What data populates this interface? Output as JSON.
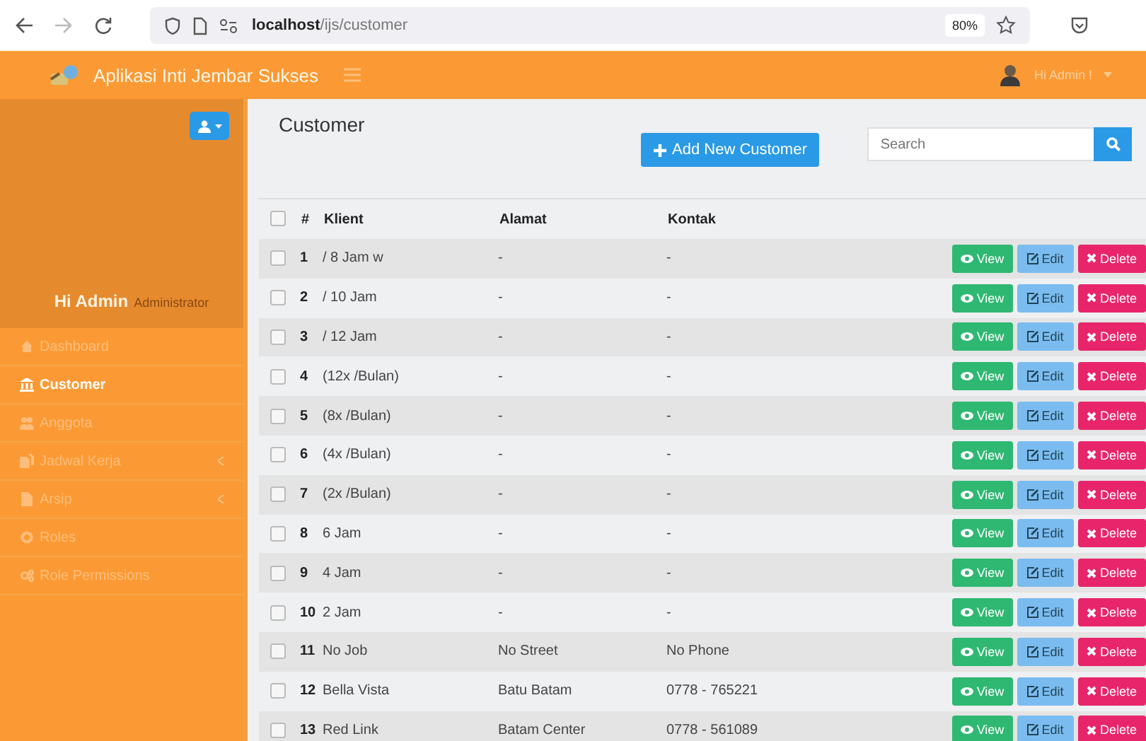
{
  "browser": {
    "url": "**localhost**/ijs/customer",
    "zoom": "80%"
  },
  "header": {
    "title": "Aplikasi Inti Jembar Sukses",
    "user": "Hi Admin !"
  },
  "sidebar": {
    "user_name": "Hi Admin",
    "user_role": "Administrator",
    "items": [
      {
        "label": "Dashboard",
        "selected": false,
        "expandable": false
      },
      {
        "label": "Customer",
        "selected": true,
        "expandable": false
      },
      {
        "label": "Anggota",
        "selected": false,
        "expandable": false
      },
      {
        "label": "Jadwal Kerja",
        "selected": false,
        "expandable": true
      },
      {
        "label": "Arsip",
        "selected": false,
        "expandable": true
      },
      {
        "label": "Roles",
        "selected": false,
        "expandable": false
      },
      {
        "label": "Role Permissions",
        "selected": false,
        "expandable": false
      }
    ]
  },
  "page": {
    "title": "Customer",
    "add_button": "Add New Customer",
    "search": {
      "placeholder": "Search"
    }
  },
  "table": {
    "columns": [
      "#",
      "Klient",
      "Alamat",
      "Kontak"
    ],
    "select_all": {
      "checked": false
    },
    "rows": [
      {
        "no": "1",
        "klient": "/ 8 Jam w",
        "alamat": "-",
        "kontak": "-",
        "checked": false,
        "actions": [
          "View",
          "Edit",
          "Delete"
        ]
      },
      {
        "no": "2",
        "klient": "/ 10 Jam",
        "alamat": "-",
        "kontak": "-",
        "checked": false,
        "actions": [
          "View",
          "Edit",
          "Delete"
        ]
      },
      {
        "no": "3",
        "klient": "/ 12 Jam",
        "alamat": "-",
        "kontak": "-",
        "checked": false,
        "actions": [
          "View",
          "Edit",
          "Delete"
        ]
      },
      {
        "no": "4",
        "klient": "(12x /Bulan)",
        "alamat": "-",
        "kontak": "-",
        "checked": false,
        "actions": [
          "View",
          "Edit",
          "Delete"
        ]
      },
      {
        "no": "5",
        "klient": "(8x /Bulan)",
        "alamat": "-",
        "kontak": "-",
        "checked": false,
        "actions": [
          "View",
          "Edit",
          "Delete"
        ]
      },
      {
        "no": "6",
        "klient": "(4x /Bulan)",
        "alamat": "-",
        "kontak": "-",
        "checked": false,
        "actions": [
          "View",
          "Edit",
          "Delete"
        ]
      },
      {
        "no": "7",
        "klient": "(2x /Bulan)",
        "alamat": "-",
        "kontak": "-",
        "checked": false,
        "actions": [
          "View",
          "Edit",
          "Delete"
        ]
      },
      {
        "no": "8",
        "klient": "6 Jam",
        "alamat": "-",
        "kontak": "-",
        "checked": false,
        "actions": [
          "View",
          "Edit",
          "Delete"
        ]
      },
      {
        "no": "9",
        "klient": "4 Jam",
        "alamat": "-",
        "kontak": "-",
        "checked": false,
        "actions": [
          "View",
          "Edit",
          "Delete"
        ]
      },
      {
        "no": "10",
        "klient": "2 Jam",
        "alamat": "-",
        "kontak": "-",
        "checked": false,
        "actions": [
          "View",
          "Edit",
          "Delete"
        ]
      },
      {
        "no": "11",
        "klient": "No Job",
        "alamat": "No Street",
        "kontak": "No Phone",
        "checked": false,
        "actions": [
          "View",
          "Edit",
          "Delete"
        ]
      },
      {
        "no": "12",
        "klient": "Bella Vista",
        "alamat": "Batu Batam",
        "kontak": "0778 - 765221",
        "checked": false,
        "actions": [
          "View",
          "Edit",
          "Delete"
        ]
      },
      {
        "no": "13",
        "klient": "Red Link",
        "alamat": "Batam Center",
        "kontak": "0778 - 561089",
        "checked": false,
        "actions": [
          "View",
          "Edit",
          "Delete"
        ]
      }
    ]
  }
}
